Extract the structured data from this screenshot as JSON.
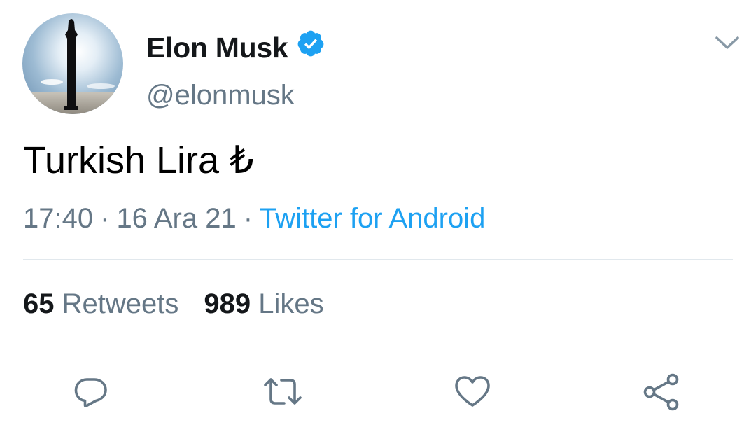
{
  "tweet": {
    "author": {
      "display_name": "Elon Musk",
      "handle": "@elonmusk",
      "verified": true,
      "avatar_icon": "rocket-silhouette-avatar"
    },
    "text": "Turkish Lira ₺",
    "meta": {
      "time": "17:40",
      "separator": "·",
      "date": "16 Ara 21",
      "source": "Twitter for Android"
    },
    "stats": {
      "retweets_count": "65",
      "retweets_label": "Retweets",
      "likes_count": "989",
      "likes_label": "Likes"
    },
    "actions": [
      {
        "name": "reply",
        "icon": "reply-icon"
      },
      {
        "name": "retweet",
        "icon": "retweet-icon"
      },
      {
        "name": "like",
        "icon": "heart-icon"
      },
      {
        "name": "share",
        "icon": "share-icon"
      }
    ]
  },
  "colors": {
    "text_primary": "#14171a",
    "text_secondary": "#657786",
    "accent": "#1da1f2",
    "icon": "#657786",
    "divider": "#e1e8ed"
  }
}
